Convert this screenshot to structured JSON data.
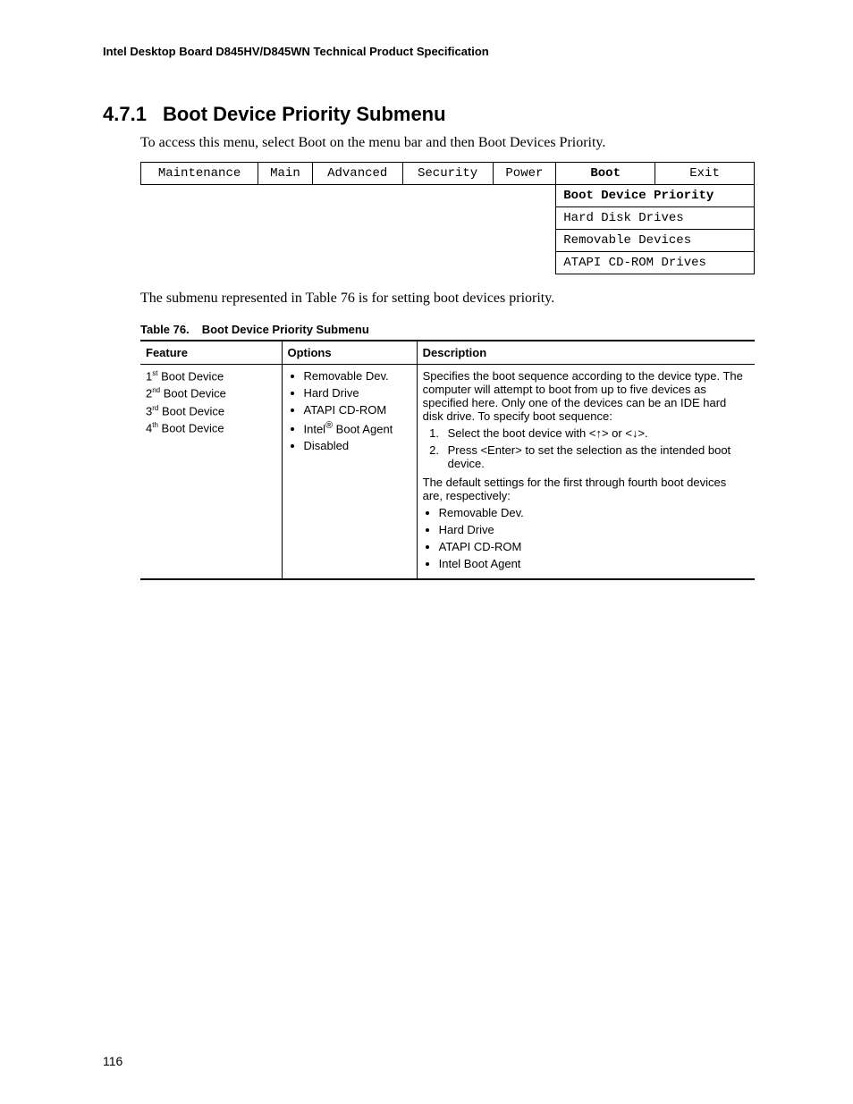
{
  "header": "Intel Desktop Board D845HV/D845WN Technical Product Specification",
  "section_number": "4.7.1",
  "section_title": "Boot Device Priority Submenu",
  "intro": "To access this menu, select Boot on the menu bar and then Boot Devices Priority.",
  "menu_tabs": {
    "maintenance": "Maintenance",
    "main": "Main",
    "advanced": "Advanced",
    "security": "Security",
    "power": "Power",
    "boot": "Boot",
    "exit": "Exit"
  },
  "submenu_items": {
    "boot_device_priority": "Boot Device Priority",
    "hard_disk_drives": "Hard Disk Drives",
    "removable_devices": "Removable Devices",
    "atapi_cdrom": "ATAPI CD-ROM Drives"
  },
  "after_menu_text": "The submenu represented in Table 76 is for setting boot devices priority.",
  "table_caption_num": "Table 76.",
  "table_caption_title": "Boot Device Priority Submenu",
  "table_headers": {
    "feature": "Feature",
    "options": "Options",
    "description": "Description"
  },
  "features": {
    "f1_pre": "1",
    "f1_sup": "st",
    "f1_post": " Boot Device",
    "f2_pre": "2",
    "f2_sup": "nd",
    "f2_post": " Boot Device",
    "f3_pre": "3",
    "f3_sup": "rd",
    "f3_post": " Boot Device",
    "f4_pre": "4",
    "f4_sup": "th",
    "f4_post": " Boot Device"
  },
  "options": {
    "o1": "Removable Dev.",
    "o2": "Hard Drive",
    "o3": "ATAPI CD-ROM",
    "o4_pre": "Intel",
    "o4_sup": "®",
    "o4_post": " Boot Agent",
    "o5": "Disabled"
  },
  "description": {
    "p1": "Specifies the boot sequence according to the device type.  The computer will attempt to boot from up to five devices as specified here.  Only one of the devices can be an IDE hard disk drive.  To specify boot sequence:",
    "n1": "Select the boot device with <↑> or <↓>.",
    "n2": "Press <Enter> to set the selection as the intended boot device.",
    "p2": "The default settings for the first through fourth boot devices are, respectively:",
    "d1": "Removable Dev.",
    "d2": "Hard Drive",
    "d3": "ATAPI CD-ROM",
    "d4": "Intel Boot Agent"
  },
  "page_number": "116"
}
